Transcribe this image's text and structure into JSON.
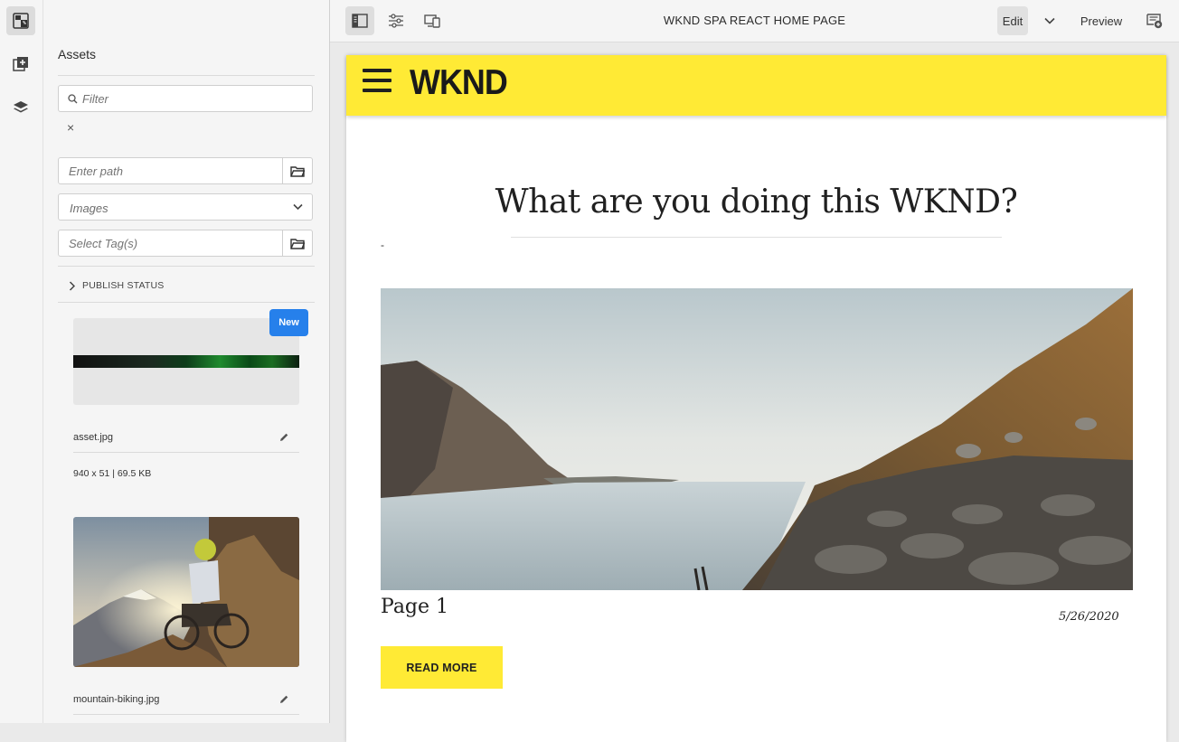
{
  "rail": {
    "items": [
      {
        "icon": "asset-finder-icon",
        "active": true
      },
      {
        "icon": "components-icon",
        "active": false
      },
      {
        "icon": "layers-icon",
        "active": false
      }
    ]
  },
  "panel": {
    "title": "Assets",
    "filter_placeholder": "Filter",
    "clear_label": "×",
    "path_placeholder": "Enter path",
    "type_value": "Images",
    "tags_placeholder": "Select Tag(s)",
    "publish_status_label": "PUBLISH STATUS",
    "assets": [
      {
        "name": "asset.jpg",
        "meta": "940 x 51 | 69.5 KB",
        "badge": "New"
      },
      {
        "name": "mountain-biking.jpg"
      }
    ]
  },
  "toolbar": {
    "page_title": "WKND SPA REACT HOME PAGE",
    "edit_label": "Edit",
    "preview_label": "Preview"
  },
  "page": {
    "logo": "WKND",
    "headline": "What are you doing this WKND?",
    "dash": "-",
    "card_title": "Page 1",
    "card_date": "5/26/2020",
    "read_more": "READ MORE",
    "accent_color": "#ffea35"
  }
}
